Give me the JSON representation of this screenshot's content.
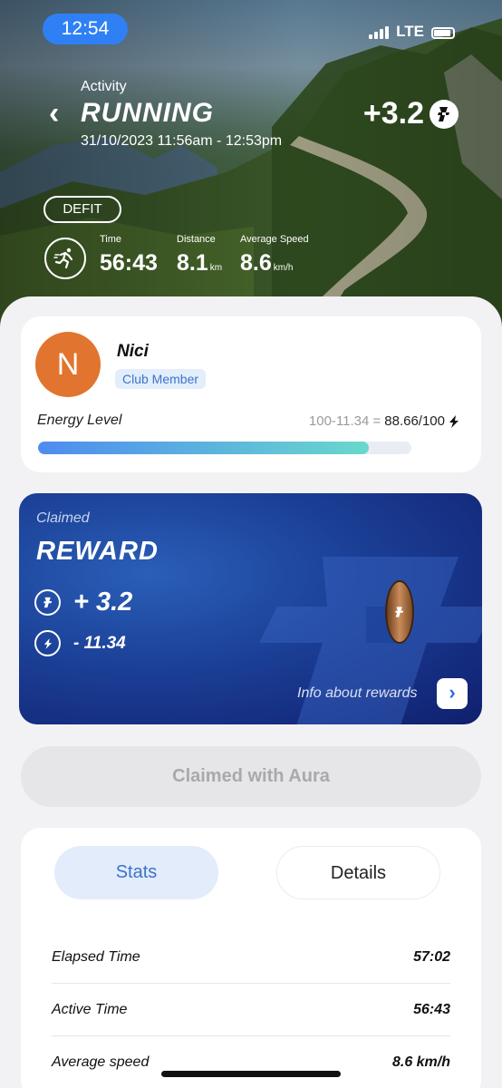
{
  "status_bar": {
    "time": "12:54",
    "network": "LTE"
  },
  "header": {
    "section_label": "Activity",
    "title": "RUNNING",
    "datetime": "31/10/2023 11:56am - 12:53pm",
    "reward": "+3.2",
    "badge": "DEFIT",
    "metrics": [
      {
        "label": "Time",
        "value": "56:43",
        "unit": ""
      },
      {
        "label": "Distance",
        "value": "8.1",
        "unit": "km"
      },
      {
        "label": "Average Speed",
        "value": "8.6",
        "unit": "km/h"
      }
    ]
  },
  "profile": {
    "initial": "N",
    "name": "Nici",
    "role": "Club Member",
    "energy_label": "Energy Level",
    "energy_calc": "100-11.34 =",
    "energy_result": "88.66/100",
    "energy_fraction": 0.8866
  },
  "reward_card": {
    "claimed_label": "Claimed",
    "title": "REWARD",
    "coins": "+ 3.2",
    "energy": "- 11.34",
    "info_label": "Info about rewards"
  },
  "claim_button": "Claimed with Aura",
  "tabs": {
    "stats": "Stats",
    "details": "Details"
  },
  "stats": [
    {
      "label": "Elapsed Time",
      "value": "57:02"
    },
    {
      "label": "Active Time",
      "value": "56:43"
    },
    {
      "label": "Average speed",
      "value": "8.6 km/h"
    }
  ],
  "colors": {
    "accent": "#2f80f5",
    "avatar": "#e1742e",
    "card": "#1b3f96"
  }
}
